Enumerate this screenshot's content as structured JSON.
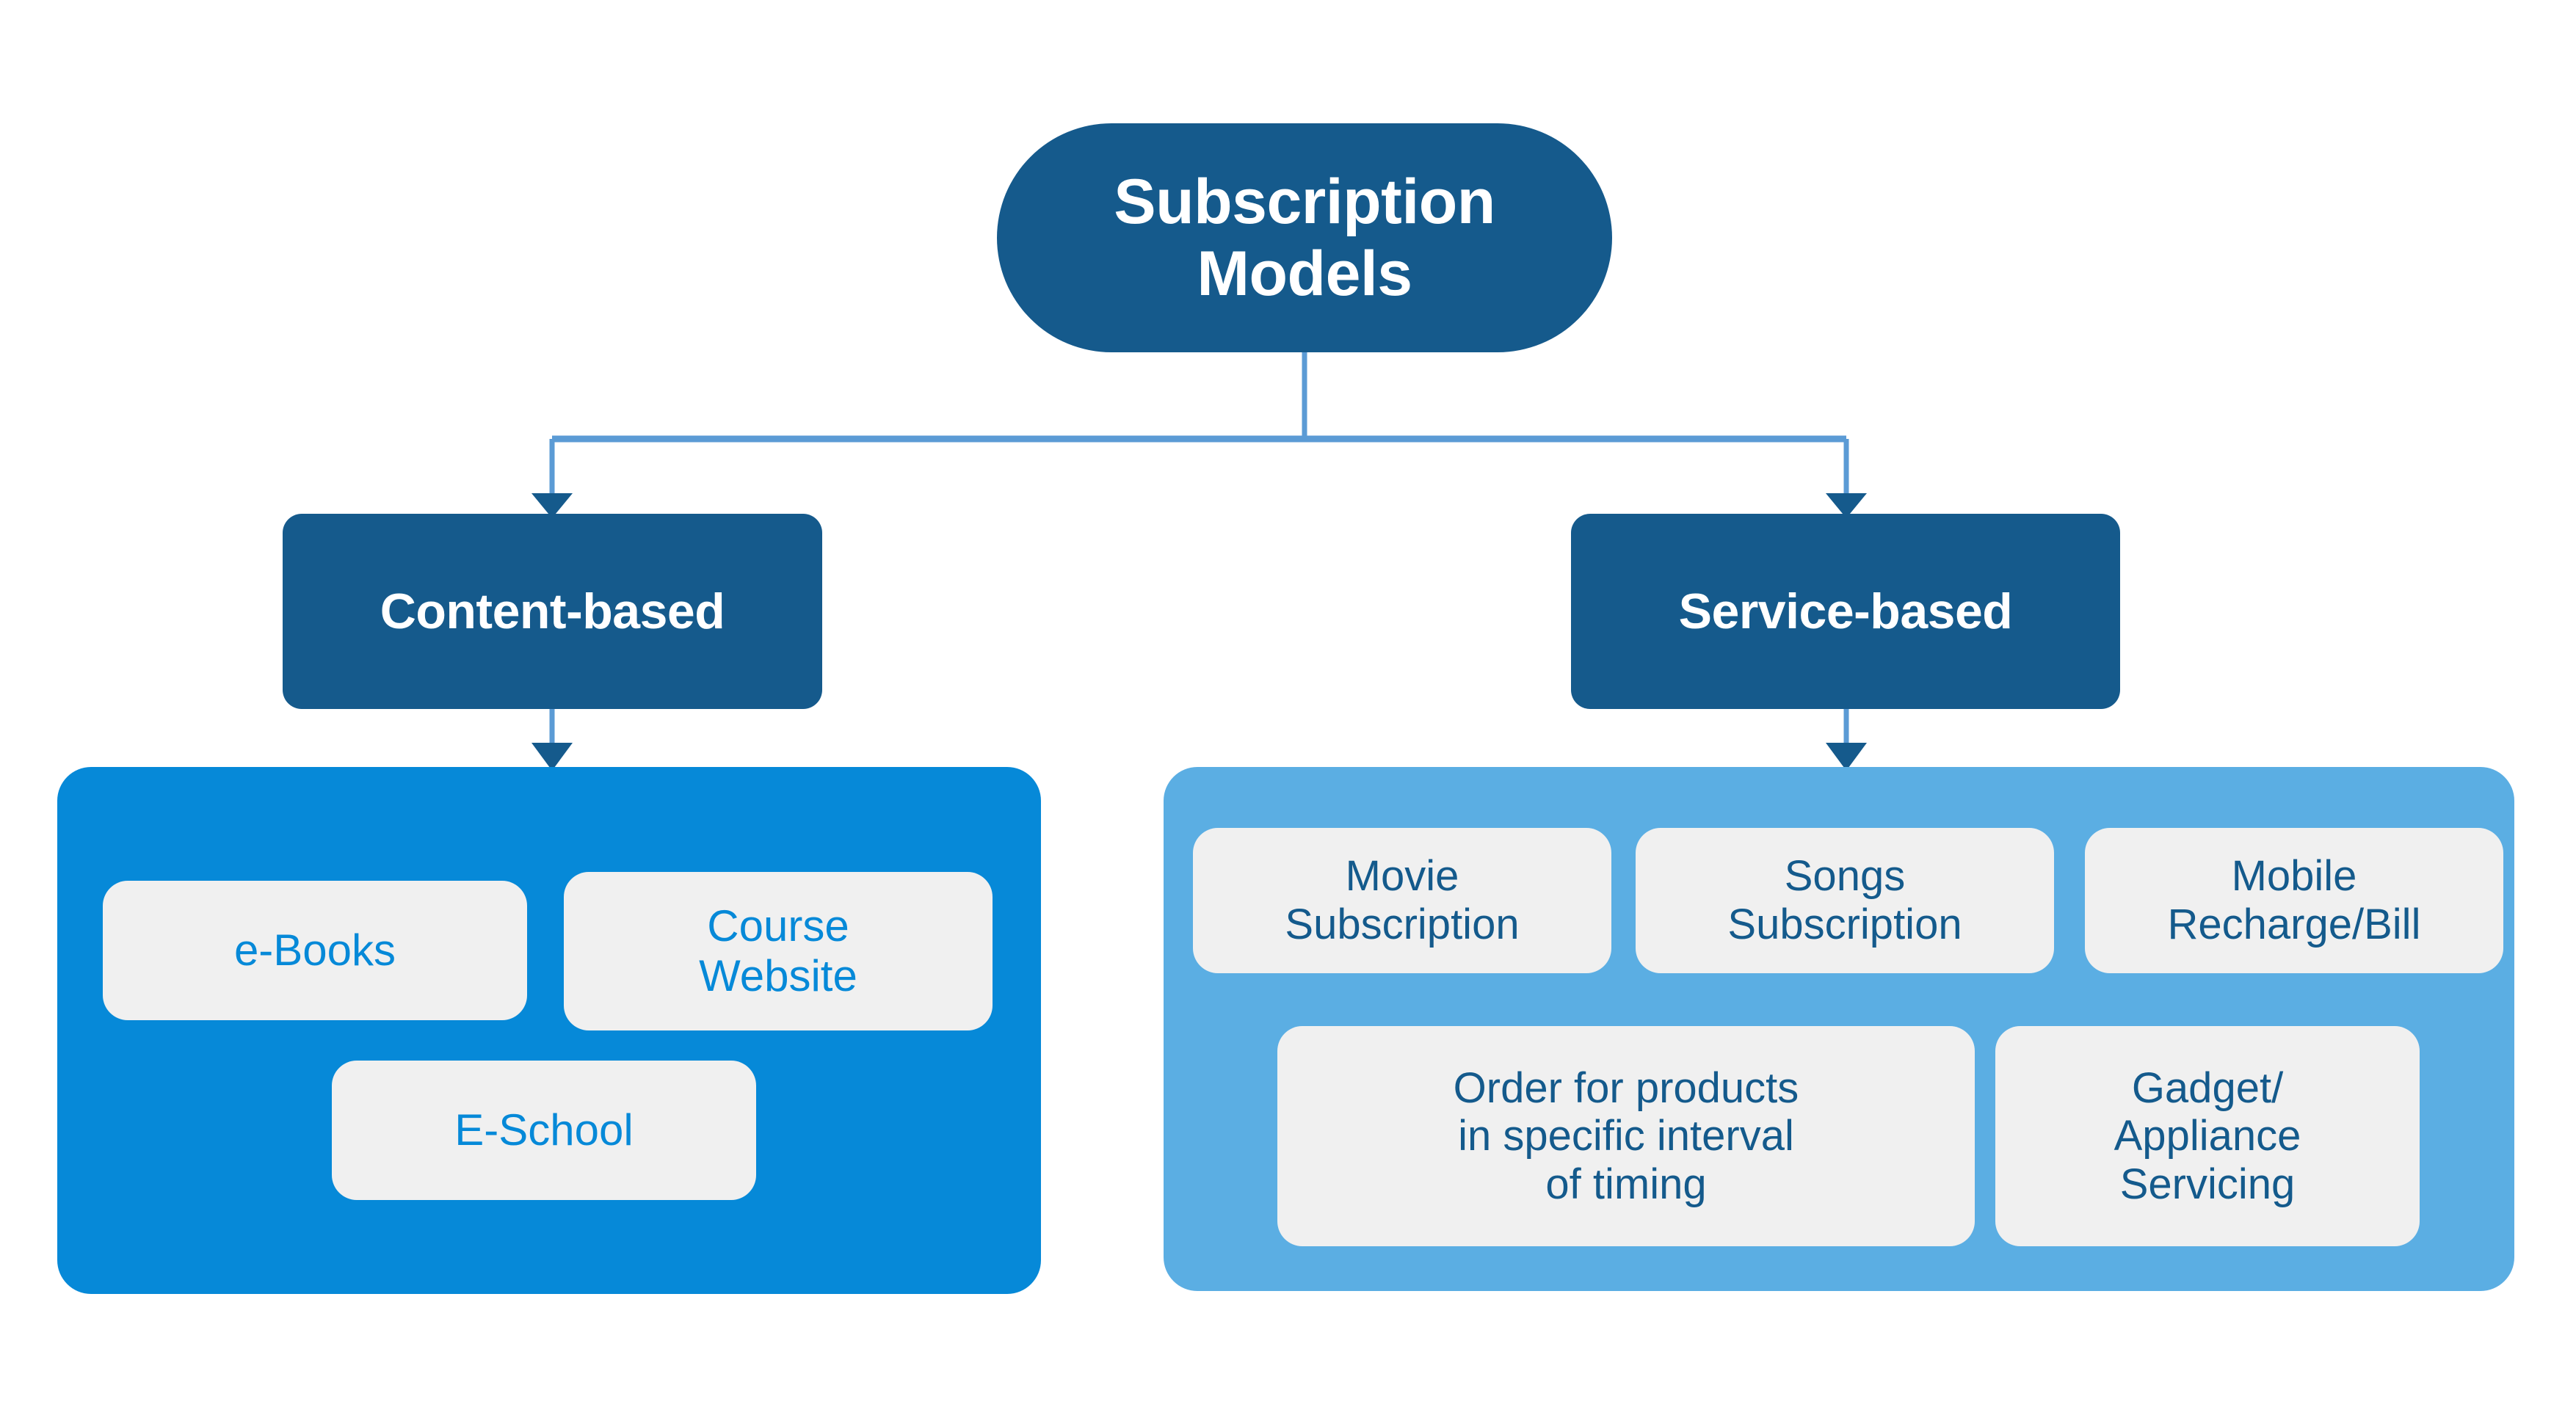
{
  "diagram": {
    "title": "Subscription Models",
    "type": "hierarchy-tree",
    "colors": {
      "node_navy": "#155A8C",
      "panel_content_blue": "#0689D8",
      "panel_service_blue": "#5BAEE3",
      "card_background": "#F0F0F0",
      "connector_line": "#5B9BD5",
      "connector_arrow": "#155A8C",
      "content_card_text": "#0689D8",
      "service_card_text": "#145A8C",
      "node_text": "#FFFFFF",
      "background": "#FFFFFF"
    },
    "root": {
      "label": "Subscription\nModels"
    },
    "branches": [
      {
        "id": "content-based",
        "label": "Content-based",
        "children": [
          {
            "label": "e-Books"
          },
          {
            "label": "Course\nWebsite"
          },
          {
            "label": "E-School"
          }
        ]
      },
      {
        "id": "service-based",
        "label": "Service-based",
        "children": [
          {
            "label": "Movie\nSubscription"
          },
          {
            "label": "Songs\nSubscription"
          },
          {
            "label": "Mobile\nRecharge/Bill"
          },
          {
            "label": "Order for products\nin specific interval\nof timing"
          },
          {
            "label": "Gadget/\nAppliance\nServicing"
          }
        ]
      }
    ]
  }
}
